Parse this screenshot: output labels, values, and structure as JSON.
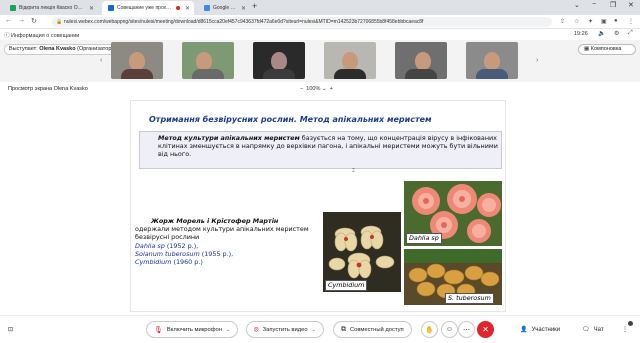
{
  "browser": {
    "tabs": [
      {
        "title": "Відкрита лекція Кваско Олени",
        "color": "#19a25b",
        "active": false
      },
      {
        "title": "Совещание уже проходит",
        "color": "#0f6bd3",
        "active": true
      },
      {
        "title": "Google Перекладач",
        "color": "#4285f4",
        "active": false
      }
    ],
    "url": "nulesi.webex.com/webappng/sites/nulesi/meeting/download/d8615cca20ef457c943637fd472a6e0d?siteurl=nulesi&MTID=m142523b72706855b8f458ebbbcaeac8f"
  },
  "meeting": {
    "info_label": "Информация о совещании",
    "time": "19:26",
    "presenter_label": "Выступает:",
    "presenter_name": "Olena Kvasko",
    "presenter_role": "(Организатор)",
    "layout_label": "Компоновка"
  },
  "share": {
    "viewer_label": "Просмотр экрана Olena Kvasko",
    "zoom": "100%"
  },
  "slide": {
    "title": "Отримання безвірусних рослин. Метод апікальних меристем",
    "method_bold": "Метод культури апікальних меристем",
    "method_text": " базується на тому, що концентрація вірусу в інфікованих клітинах зменшується в напрямку до верхівки пагона, і апікальні меристеми можуть бути вільними від нього.",
    "authors_name": "Жорж Морель і Крістофер Мартін",
    "authors_text": "одержали методом культури апікальних меристем безвірусні рослини",
    "species": [
      {
        "name": "Dahlia sp",
        "year": " (1952 р.),"
      },
      {
        "name": "Solanum tuberosum",
        "year": " (1955 р.),"
      },
      {
        "name": "Cymbidium",
        "year": " (1960 р.)"
      }
    ],
    "photo_captions": {
      "cymbidium": "Cymbidium",
      "dahlia": "Dahlia sp",
      "tuberosum": "S. tuberosum"
    }
  },
  "toolbar": {
    "mic_label": "Включить микрофон",
    "video_label": "Запустить видео",
    "share_label": "Совместный доступ",
    "participants_label": "Участники",
    "chat_label": "Чат"
  }
}
